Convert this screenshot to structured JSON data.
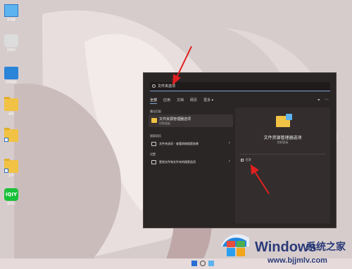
{
  "desktop": {
    "icons": [
      {
        "label": "此电脑",
        "icon": "computer-icon"
      },
      {
        "label": "回收站",
        "icon": "recycle-bin-icon"
      },
      {
        "label": "控制面板",
        "icon": "control-panel-icon"
      },
      {
        "label": "桌面",
        "icon": "folder-icon"
      },
      {
        "label": "",
        "icon": "folder-shortcut-icon"
      },
      {
        "label": "文件",
        "icon": "folder-shortcut-icon"
      },
      {
        "label": "爱奇艺",
        "icon": "iqiyi-icon",
        "glyph": "iQIY"
      }
    ]
  },
  "search": {
    "query": "文件夹选项",
    "tabs": [
      "全部",
      "应用",
      "文档",
      "网页",
      "更多 ▾"
    ],
    "tools": [
      "⚭",
      "···"
    ],
    "best_match_title": "最佳匹配",
    "best_match": {
      "title": "文件资源管理器选项",
      "subtitle": "控制面板"
    },
    "web_title": "搜索网页",
    "web_item": "文件夹选项 - 查看网络搜索结果",
    "settings_title": "设置",
    "settings_item": "更改文件和文件夹的搜索选项",
    "preview": {
      "title": "文件资源管理器选项",
      "subtitle": "控制面板",
      "open_label": "打开"
    }
  },
  "watermark": {
    "brand": "Windows",
    "cn": "系统之家",
    "url": "www.bjjmlv.com"
  },
  "colors": {
    "panel": "#2b2626",
    "accent": "#7aa7d9",
    "arrow": "#e02020",
    "folder": "#f1c243"
  }
}
